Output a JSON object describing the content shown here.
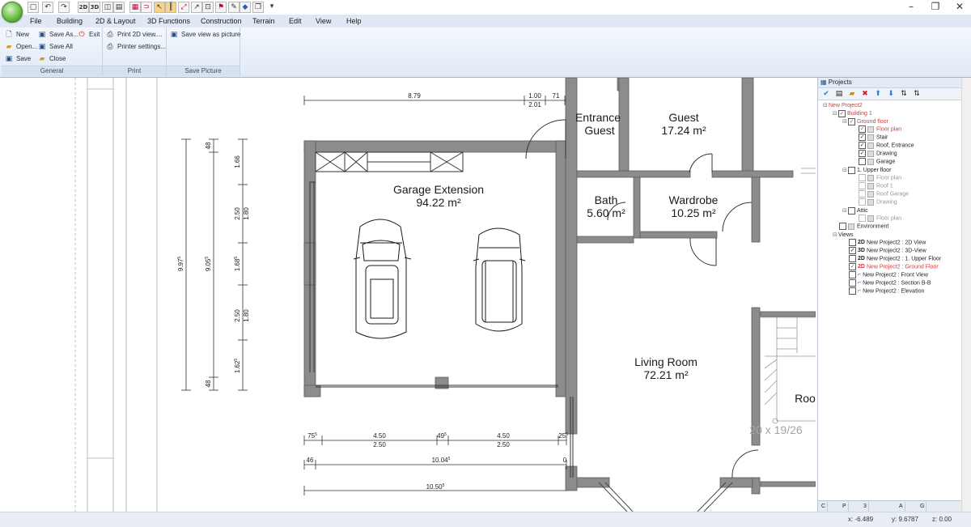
{
  "menu": {
    "items": [
      "File",
      "Building",
      "2D & Layout",
      "3D Functions",
      "Construction",
      "Terrain",
      "Edit",
      "View",
      "Help"
    ]
  },
  "quick_access": {
    "labels": [
      "2D",
      "3D"
    ]
  },
  "ribbon": {
    "general": {
      "label": "General",
      "new": "New",
      "open": "Open...",
      "save": "Save",
      "save_as": "Save As...",
      "save_all": "Save All",
      "close": "Close",
      "exit": "Exit"
    },
    "print": {
      "label": "Print",
      "print_2d": "Print 2D view....",
      "printer_settings": "Printer settings..."
    },
    "save_picture": {
      "label": "Save Picture",
      "save_view": "Save view as picture"
    }
  },
  "plan": {
    "rooms": {
      "garage": {
        "name": "Garage Extension",
        "area": "94.22 m²"
      },
      "entrance": {
        "name1": "Entrance",
        "name2": "Guest"
      },
      "guest": {
        "name": "Guest",
        "area": "17.24 m²"
      },
      "bath": {
        "name": "Bath",
        "area": "5.60 m²"
      },
      "wardrobe": {
        "name": "Wardrobe",
        "area": "10.25 m²"
      },
      "living": {
        "name": "Living Room",
        "area": "72.21 m²"
      },
      "roo": {
        "name": "Roo"
      }
    },
    "stairs_label": "20 x 19/26",
    "dims_top": {
      "a": "8.79",
      "b": "1.00",
      "c": "2.01",
      "d": "71"
    },
    "dims_bottom": {
      "r1a": "75",
      "r1a_sup": "5",
      "r1b": "4.50",
      "r1c": "2.50",
      "r1d": "49",
      "r1d_sup": "5",
      "r1e": "4.50",
      "r1f": "2.50",
      "r1g": "25",
      "r1g_sup": "5",
      "r2a": "46",
      "r2b": "10.04",
      "r2b_sup": "5",
      "r2c": "0",
      "r3": "10.50",
      "r3_sup": "5"
    },
    "dims_left": {
      "v1": "9.97",
      "v1_sup": "5",
      "v2": "9.05",
      "v2_sup": "5",
      "s1": "48",
      "s2": "1.66",
      "s3": "2.50",
      "s4": "1.80",
      "s5": "1.68",
      "s5_sup": "5",
      "s6": "2.50",
      "s7": "1.80",
      "s8": "1.62",
      "s8_sup": "5",
      "s9": "48"
    }
  },
  "panel": {
    "title": "Projects",
    "tree": {
      "project": "New Project2",
      "building": "Building 1",
      "ground_floor": "Ground floor",
      "floor_plan": "Floor plan",
      "stair": "Stair",
      "roof_entrance": "Roof, Entrance",
      "drawing": "Drawing",
      "garage": "Garage",
      "upper_floor": "1. Upper floor",
      "uf_floor_plan": "Floor plan",
      "roof1": "Roof 1",
      "roof_garage": "Roof Garage",
      "uf_drawing": "Drawing",
      "attic": "Attic",
      "attic_floor_plan": "Floor plan",
      "environment": "Environment",
      "views": "Views",
      "view_2d": "New Project2 : 2D View",
      "view_3d": "New Project2 : 3D-View",
      "view_upper": "New Project2 : 1. Upper Floor",
      "view_ground": "New Project2 : Ground Floor",
      "view_front": "New Project2 : Front View",
      "view_section": "New Project2 : Section B-B",
      "view_elevation": "New Project2 : Elevation"
    },
    "tabs": [
      "C",
      "P",
      "3",
      "A",
      "G"
    ]
  },
  "status": {
    "x": "x: -6.489",
    "y": "y: 9.6787",
    "z": "z: 0.00"
  }
}
